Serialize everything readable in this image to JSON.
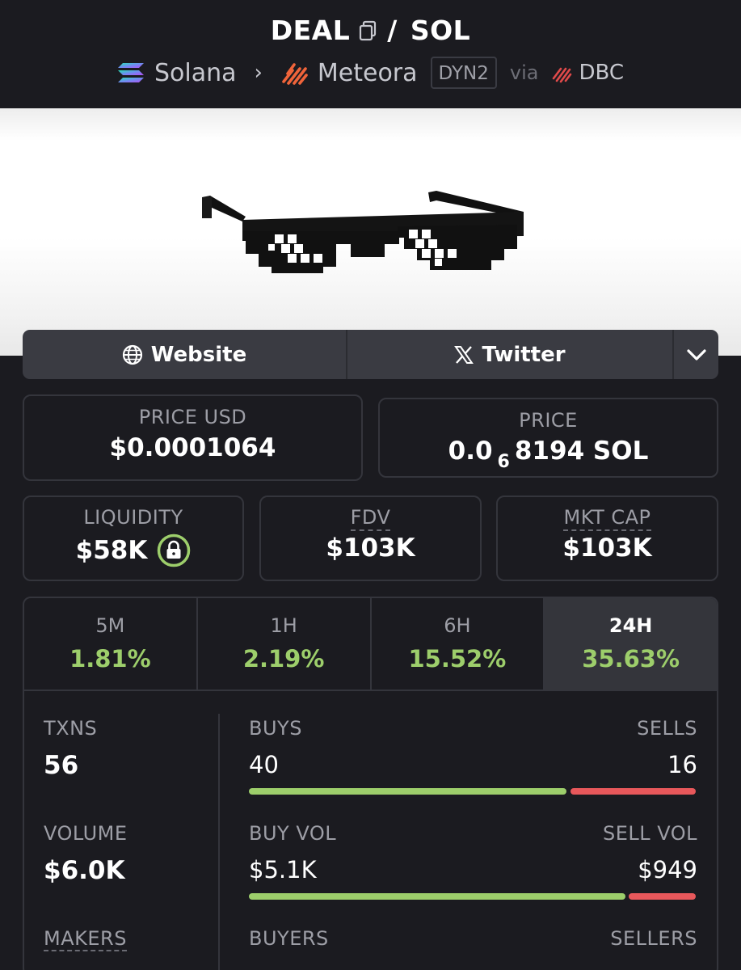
{
  "header": {
    "base_token": "DEAL",
    "separator": "/",
    "quote_token": "SOL",
    "chain": "Solana",
    "dex": "Meteora",
    "pool_badge": "DYN2",
    "via": "via",
    "launchpad": "DBC"
  },
  "links": {
    "website": "Website",
    "twitter": "Twitter"
  },
  "price": {
    "usd_label": "PRICE USD",
    "usd_value": "$0.0001064",
    "native_label": "PRICE",
    "native_prefix": "0.0",
    "native_zeros": "6",
    "native_suffix": "8194 SOL"
  },
  "metrics": {
    "liquidity_label": "LIQUIDITY",
    "liquidity_value": "$58K",
    "fdv_label": "FDV",
    "fdv_value": "$103K",
    "mcap_label": "MKT CAP",
    "mcap_value": "$103K"
  },
  "timeframes": [
    {
      "label": "5M",
      "change": "1.81%"
    },
    {
      "label": "1H",
      "change": "2.19%"
    },
    {
      "label": "6H",
      "change": "15.52%"
    },
    {
      "label": "24H",
      "change": "35.63%",
      "selected": true
    }
  ],
  "stats": {
    "txns_label": "TXNS",
    "txns_value": "56",
    "buys_label": "BUYS",
    "buys_value": "40",
    "sells_label": "SELLS",
    "sells_value": "16",
    "buys_ratio": 0.714,
    "volume_label": "VOLUME",
    "volume_value": "$6.0K",
    "buy_vol_label": "BUY VOL",
    "buy_vol_value": "$5.1K",
    "sell_vol_label": "SELL VOL",
    "sell_vol_value": "$949",
    "buy_vol_ratio": 0.843,
    "makers_label": "MAKERS",
    "buyers_label": "BUYERS",
    "sellers_label": "SELLERS"
  },
  "colors": {
    "positive": "#9dce6b",
    "negative": "#e8585b",
    "background": "#1b1b20",
    "card_border": "#34353c"
  }
}
